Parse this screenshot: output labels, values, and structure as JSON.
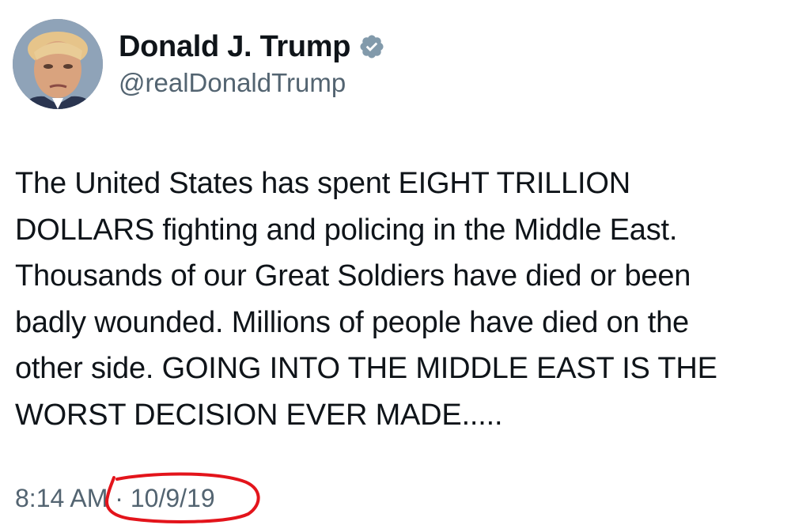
{
  "author": {
    "display_name": "Donald J. Trump",
    "handle": "@realDonaldTrump",
    "verified_icon": "verified-badge-icon",
    "avatar_icon": "profile-photo"
  },
  "tweet": {
    "lines": [
      "The United States has spent EIGHT TRILLION",
      "DOLLARS fighting and policing in the Middle East.",
      "Thousands of our Great Soldiers have died or been",
      "badly wounded. Millions of people have died on the",
      "other side. GOING INTO THE MIDDLE EAST IS THE",
      "WORST DECISION EVER MADE....."
    ],
    "time": "8:14 AM",
    "separator": " · ",
    "date": "10/9/19"
  },
  "colors": {
    "text": "#0f1419",
    "muted": "#536471",
    "verified_badge": "#829aab",
    "annotation": "#e3141b"
  }
}
